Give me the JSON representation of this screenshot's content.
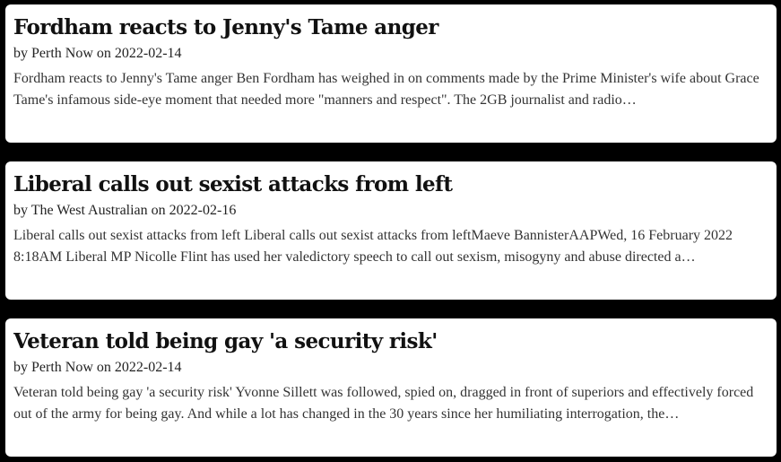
{
  "articles": [
    {
      "title": "Fordham reacts to Jenny's Tame anger",
      "meta": "by Perth Now on 2022-02-14",
      "excerpt": "Fordham reacts to Jenny's Tame anger Ben Fordham has weighed in on comments made by the Prime Minister's wife about Grace Tame's infamous side-eye moment that needed more \"manners and respect\". The 2GB journalist and radio…"
    },
    {
      "title": "Liberal calls out sexist attacks from left",
      "meta": "by The West Australian on 2022-02-16",
      "excerpt": "Liberal calls out sexist attacks from left Liberal calls out sexist attacks from leftMaeve BannisterAAPWed, 16 February 2022 8:18AM Liberal MP Nicolle Flint has used her valedictory speech to call out sexism, misogyny and abuse directed a…"
    },
    {
      "title": "Veteran told being gay 'a security risk'",
      "meta": "by Perth Now on 2022-02-14",
      "excerpt": "Veteran told being gay 'a security risk' Yvonne Sillett was followed, spied on, dragged in front of superiors and effectively forced out of the army for being gay. And while a lot has changed in the 30 years since her humiliating interrogation, the…"
    }
  ]
}
